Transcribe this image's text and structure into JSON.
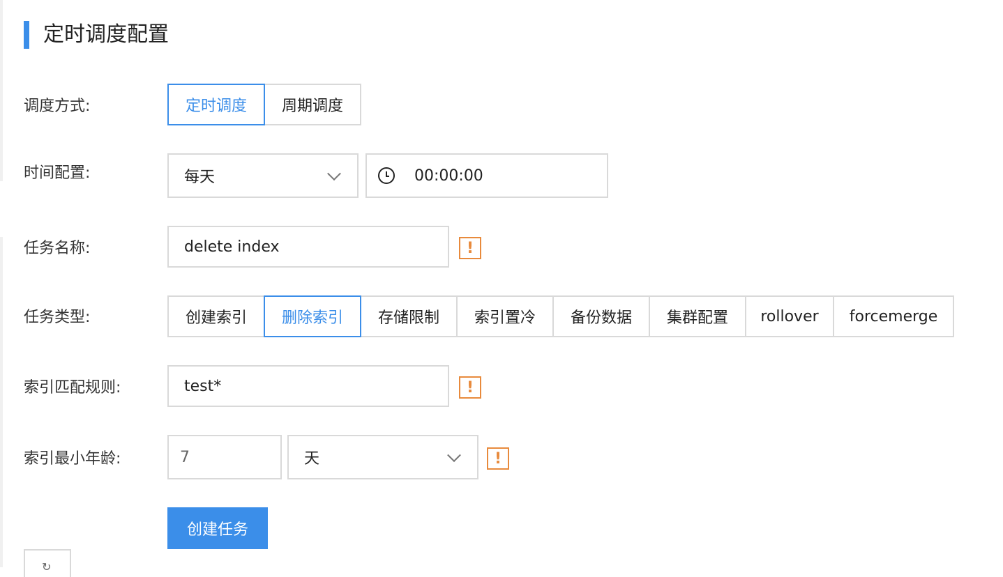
{
  "page": {
    "title": "定时调度配置"
  },
  "schedule_mode": {
    "label": "调度方式:",
    "options": [
      "定时调度",
      "周期调度"
    ],
    "selected": "定时调度"
  },
  "time_config": {
    "label": "时间配置:",
    "frequency": "每天",
    "time": "00:00:00"
  },
  "task_name": {
    "label": "任务名称:",
    "value": "delete index",
    "warning": "!"
  },
  "task_type": {
    "label": "任务类型:",
    "options": [
      "创建索引",
      "删除索引",
      "存储限制",
      "索引置冷",
      "备份数据",
      "集群配置",
      "rollover",
      "forcemerge"
    ],
    "selected": "删除索引"
  },
  "index_pattern": {
    "label": "索引匹配规则:",
    "value": "test*",
    "warning": "!"
  },
  "index_min_age": {
    "label": "索引最小年龄:",
    "value": "7",
    "unit": "天",
    "warning": "!"
  },
  "actions": {
    "create_label": "创建任务",
    "refresh_icon": "refresh-icon"
  },
  "colors": {
    "accent": "#3b8ee9",
    "warning": "#e88a3c",
    "border": "#d9d9d9"
  }
}
